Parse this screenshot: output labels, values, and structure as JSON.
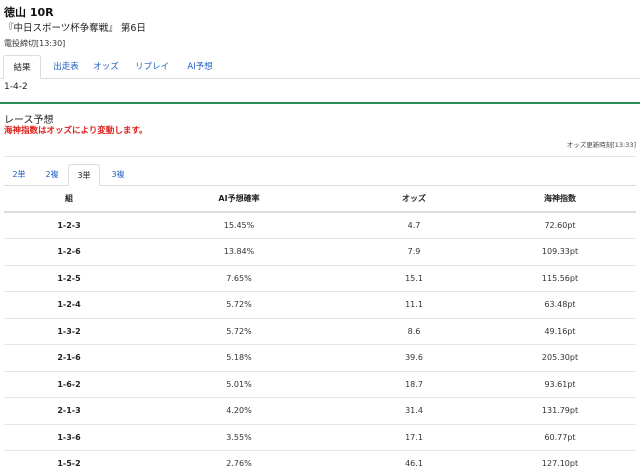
{
  "header": {
    "title": "徳山 10R",
    "subtitle": "『中日スポーツ杯争奪戦』 第6日",
    "deadline": "電投締切[13:30]"
  },
  "tabs": [
    {
      "label": "結果",
      "active": true
    },
    {
      "label": "出走表",
      "active": false
    },
    {
      "label": "オッズ",
      "active": false
    },
    {
      "label": "リプレイ",
      "active": false
    },
    {
      "label": "AI予想",
      "active": false
    }
  ],
  "result": "1-4-2",
  "prediction": {
    "title": "レース予想",
    "note": "海神指数はオッズにより変動します。",
    "updated": "オッズ更新時刻[13:33]"
  },
  "bet_tabs": [
    {
      "label": "2単",
      "active": false
    },
    {
      "label": "2複",
      "active": false
    },
    {
      "label": "3単",
      "active": true
    },
    {
      "label": "3複",
      "active": false
    }
  ],
  "table": {
    "headers": [
      "組",
      "AI予想確率",
      "オッズ",
      "海神指数"
    ],
    "rows": [
      [
        "1-2-3",
        "15.45%",
        "4.7",
        "72.60pt"
      ],
      [
        "1-2-6",
        "13.84%",
        "7.9",
        "109.33pt"
      ],
      [
        "1-2-5",
        "7.65%",
        "15.1",
        "115.56pt"
      ],
      [
        "1-2-4",
        "5.72%",
        "11.1",
        "63.48pt"
      ],
      [
        "1-3-2",
        "5.72%",
        "8.6",
        "49.16pt"
      ],
      [
        "2-1-6",
        "5.18%",
        "39.6",
        "205.30pt"
      ],
      [
        "1-6-2",
        "5.01%",
        "18.7",
        "93.61pt"
      ],
      [
        "2-1-3",
        "4.20%",
        "31.4",
        "131.79pt"
      ],
      [
        "1-3-6",
        "3.55%",
        "17.1",
        "60.77pt"
      ],
      [
        "1-5-2",
        "2.76%",
        "46.1",
        "127.10pt"
      ]
    ]
  },
  "colors": {
    "link": "#1e5fbf",
    "warning": "#e0201a",
    "divider_accent": "#2e8b57"
  }
}
